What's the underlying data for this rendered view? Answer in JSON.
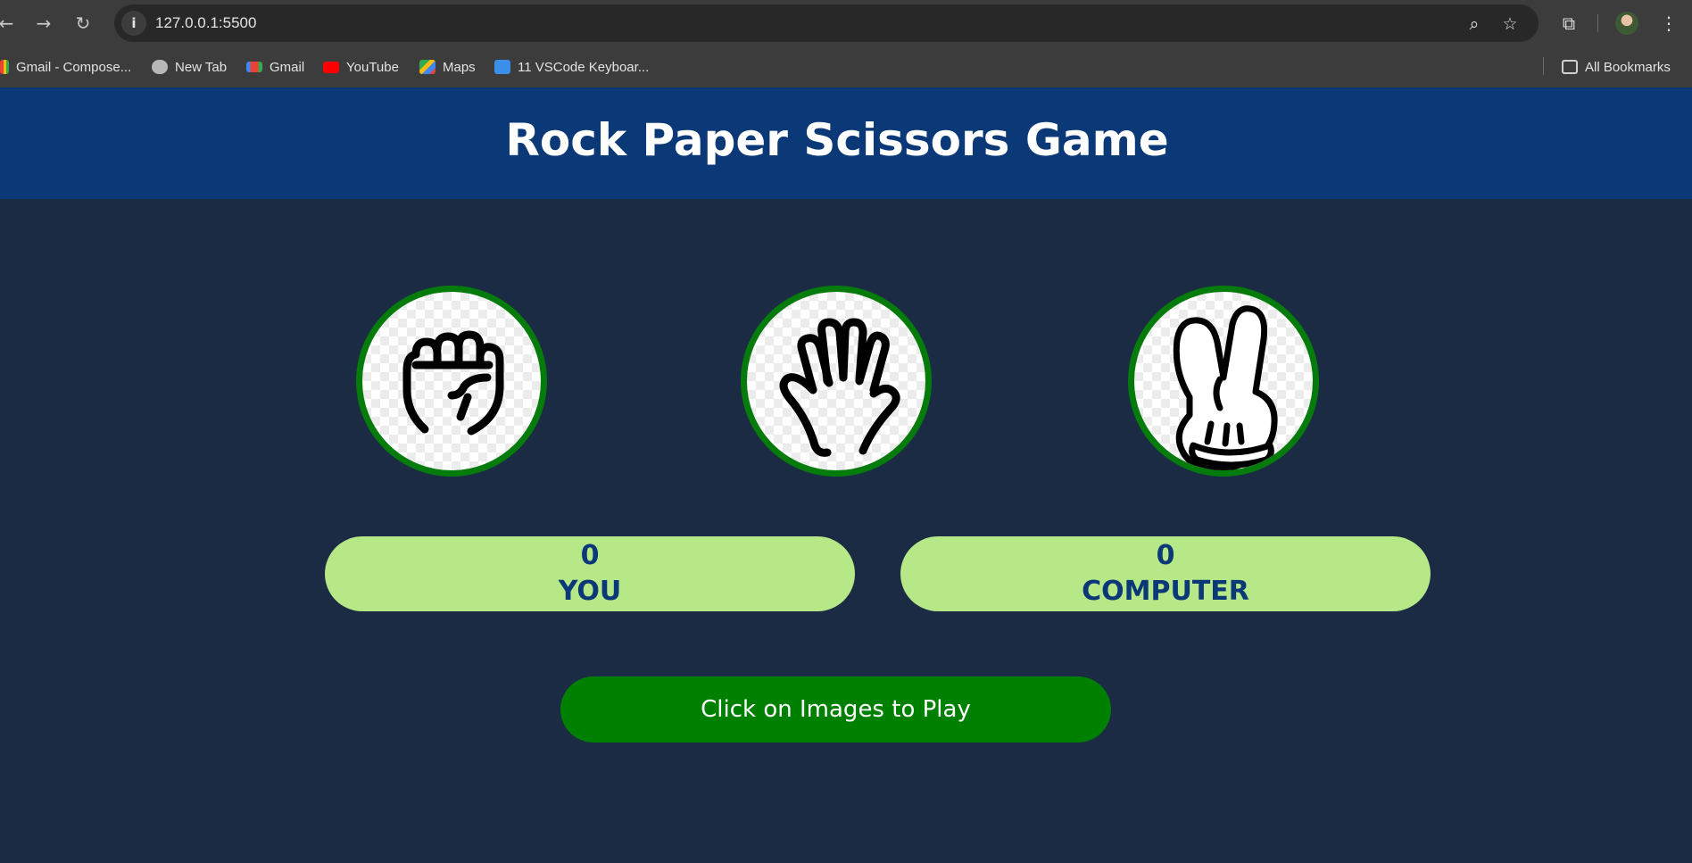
{
  "browser": {
    "url": "127.0.0.1:5500",
    "bookmarks": [
      {
        "label": "Gmail - Compose...",
        "icon": "gmail-icon"
      },
      {
        "label": "New Tab",
        "icon": "globe-icon"
      },
      {
        "label": "Gmail",
        "icon": "gmail-icon"
      },
      {
        "label": "YouTube",
        "icon": "youtube-icon"
      },
      {
        "label": "Maps",
        "icon": "maps-icon"
      },
      {
        "label": "11 VSCode Keyboar...",
        "icon": "info-icon"
      }
    ],
    "all_bookmarks": "All Bookmarks"
  },
  "game": {
    "title": "Rock Paper Scissors Game",
    "choices": [
      {
        "name": "rock",
        "icon": "fist-icon"
      },
      {
        "name": "paper",
        "icon": "open-hand-icon"
      },
      {
        "name": "scissors",
        "icon": "two-fingers-icon"
      }
    ],
    "scores": {
      "user": {
        "value": "0",
        "label": "YOU"
      },
      "computer": {
        "value": "0",
        "label": "COMPUTER"
      }
    },
    "message": "Click on Images to Play"
  },
  "colors": {
    "header_bg": "#0b3876",
    "page_bg": "#1b2b44",
    "score_bg": "#b6e887",
    "score_text": "#0b3876",
    "ring": "#047b0b",
    "message_bg": "#008000"
  }
}
